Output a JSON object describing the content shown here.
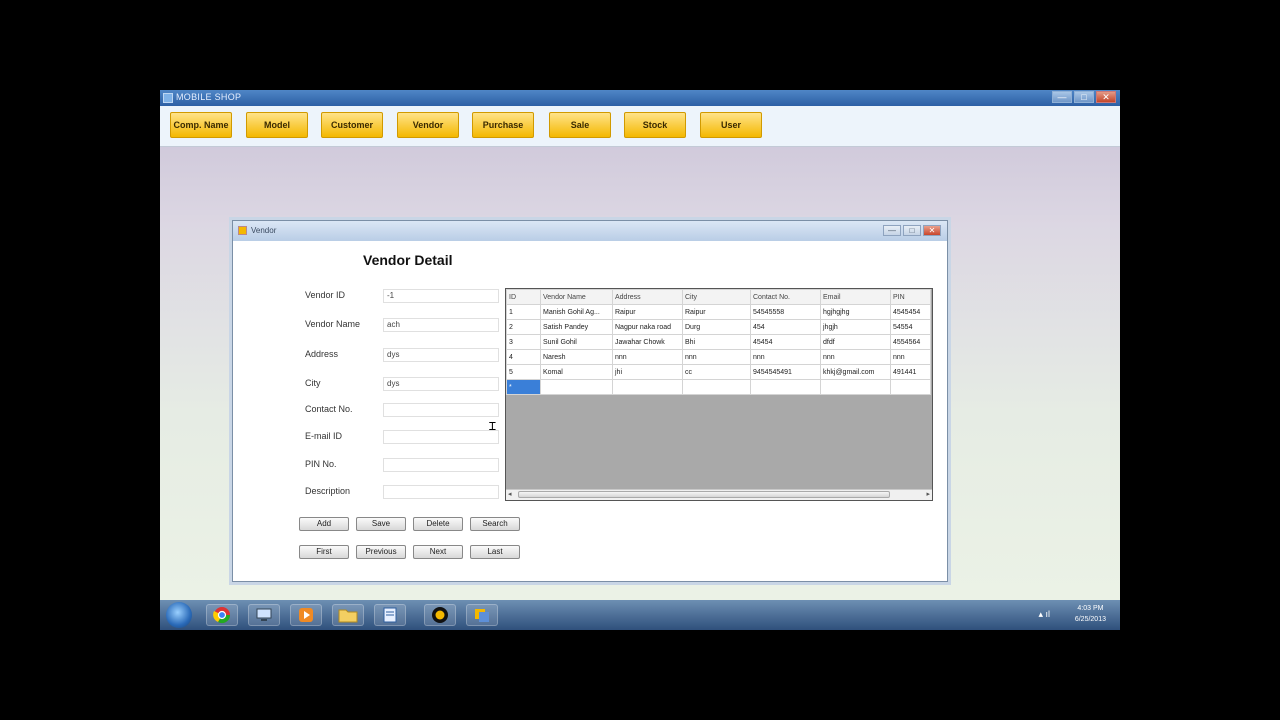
{
  "app": {
    "title": "MOBILE SHOP"
  },
  "window_controls": {
    "minimize": "—",
    "maximize": "□",
    "close": "✕"
  },
  "menu": [
    {
      "label": "Comp. Name"
    },
    {
      "label": "Model"
    },
    {
      "label": "Customer"
    },
    {
      "label": "Vendor"
    },
    {
      "label": "Purchase"
    },
    {
      "label": "Sale"
    },
    {
      "label": "Stock"
    },
    {
      "label": "User"
    }
  ],
  "vendor_window": {
    "title": "Vendor",
    "heading": "Vendor Detail",
    "fields": [
      {
        "label": "Vendor ID",
        "value": "-1"
      },
      {
        "label": "Vendor Name",
        "value": "ach"
      },
      {
        "label": "Address",
        "value": "dys"
      },
      {
        "label": "City",
        "value": "dys"
      },
      {
        "label": "Contact No.",
        "value": ""
      },
      {
        "label": "E-mail ID",
        "value": ""
      },
      {
        "label": "PIN No.",
        "value": ""
      },
      {
        "label": "Description",
        "value": ""
      }
    ],
    "buttons_row1": [
      {
        "label": "Add"
      },
      {
        "label": "Save"
      },
      {
        "label": "Delete"
      },
      {
        "label": "Search"
      }
    ],
    "buttons_row2": [
      {
        "label": "First"
      },
      {
        "label": "Previous"
      },
      {
        "label": "Next"
      },
      {
        "label": "Last"
      }
    ],
    "grid": {
      "columns": [
        "ID",
        "Vendor Name",
        "Address",
        "City",
        "Contact No.",
        "Email",
        "PIN"
      ],
      "rows": [
        [
          "1",
          "Manish Gohil Ag...",
          "Raipur",
          "Raipur",
          "54545558",
          "hgjhgjhg",
          "4545454"
        ],
        [
          "2",
          "Satish Pandey",
          "Nagpur naka road",
          "Durg",
          "454",
          "jhgjh",
          "54554"
        ],
        [
          "3",
          "Sunil Gohil",
          "Jawahar Chowk",
          "Bhi",
          "45454",
          "dfdf",
          "4554564"
        ],
        [
          "4",
          "Naresh",
          "nnn",
          "nnn",
          "nnn",
          "nnn",
          "nnn"
        ],
        [
          "5",
          "Komal",
          "jhi",
          "cc",
          "9454545491",
          "khkj@gmail.com",
          "491441"
        ],
        [
          "*",
          "",
          "",
          "",
          "",
          "",
          ""
        ]
      ],
      "scroll_arrows": {
        "left": "◂",
        "right": "▸"
      }
    }
  },
  "taskbar": {
    "time": "4:03 PM",
    "date": "6/25/2013",
    "tray": "▴ ıl",
    "icons": [
      "chrome-icon",
      "network-icon",
      "media-player-icon",
      "explorer-icon",
      "notepad-icon",
      "app-icon",
      "mobile-shop-icon"
    ]
  }
}
